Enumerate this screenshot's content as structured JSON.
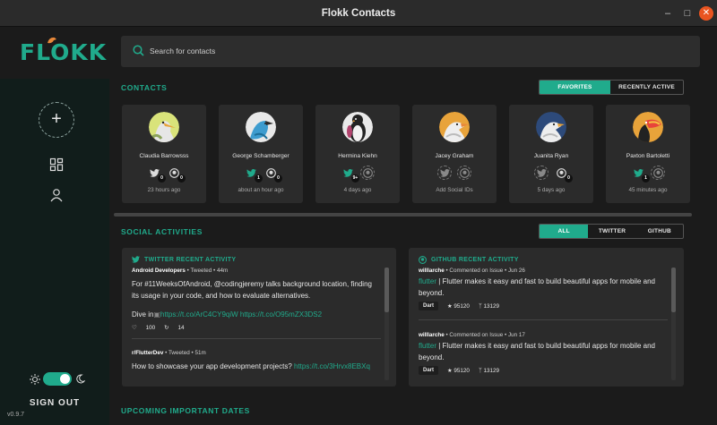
{
  "window": {
    "title": "Flokk Contacts"
  },
  "app": {
    "logo_text": "FLOKK",
    "version": "v0.9.7",
    "sign_out": "SIGN OUT",
    "add_label": "+"
  },
  "search": {
    "placeholder": "Search for contacts"
  },
  "contacts_section": {
    "title": "CONTACTS",
    "filters": [
      "FAVORITES",
      "RECENTLY ACTIVE"
    ],
    "active_filter": "FAVORITES",
    "cards": [
      {
        "name": "Claudia Barrowsss",
        "twitter": "0",
        "github": "0",
        "time": "23 hours ago"
      },
      {
        "name": "George Schamberger",
        "twitter": "1",
        "github": "0",
        "time": "about an hour ago"
      },
      {
        "name": "Hermina Kiehn",
        "twitter": "9+",
        "github": "",
        "time": "4 days ago"
      },
      {
        "name": "Jacey Graham",
        "twitter": "",
        "github": "",
        "time": "Add Social IDs"
      },
      {
        "name": "Juanita Ryan",
        "twitter": "",
        "github": "0",
        "time": "5 days ago"
      },
      {
        "name": "Paxton Bartoletti",
        "twitter": "1",
        "github": "",
        "time": "45 minutes ago"
      }
    ]
  },
  "social_section": {
    "title": "SOCIAL ACTIVITIES",
    "filters": [
      "ALL",
      "TWITTER",
      "GITHUB"
    ],
    "active_filter": "ALL"
  },
  "twitter_panel": {
    "title": "TWITTER RECENT ACTIVITY",
    "items": [
      {
        "author": "Android Developers",
        "action": "Tweeted",
        "time": "44m",
        "text": "For #11WeeksOfAndroid, @codingjeremy talks background location, finding its usage in your code, and how to evaluate alternatives.",
        "dive_prefix": "Dive in",
        "links": "https://t.co/ArC4CY9qiW https://t.co/O95mZX3DS2",
        "likes": "100",
        "retweets": "14"
      },
      {
        "author": "r/FlutterDev",
        "action": "Tweeted",
        "time": "51m",
        "text": "How to showcase your app development projects?",
        "links": "https://t.co/3Hrvx8EBXq"
      }
    ]
  },
  "github_panel": {
    "title": "GITHUB RECENT ACTIVITY",
    "items": [
      {
        "author": "willlarche",
        "action": "Commented on Issue",
        "date": "Jun 26",
        "repo": "flutter",
        "text": " | Flutter makes it easy and fast to build beautiful apps for mobile and beyond.",
        "language": "Dart",
        "stars": "95120",
        "forks": "13129"
      },
      {
        "author": "willlarche",
        "action": "Commented on Issue",
        "date": "Jun 17",
        "repo": "flutter",
        "text": " | Flutter makes it easy and fast to build beautiful apps for mobile and beyond.",
        "language": "Dart",
        "stars": "95120",
        "forks": "13129"
      }
    ]
  },
  "upcoming_section": {
    "title": "UPCOMING IMPORTANT DATES"
  },
  "colors": {
    "accent": "#20ab8c",
    "background": "#1b1b1b",
    "card": "#2b2b2b",
    "sidebar": "#111d1b"
  }
}
